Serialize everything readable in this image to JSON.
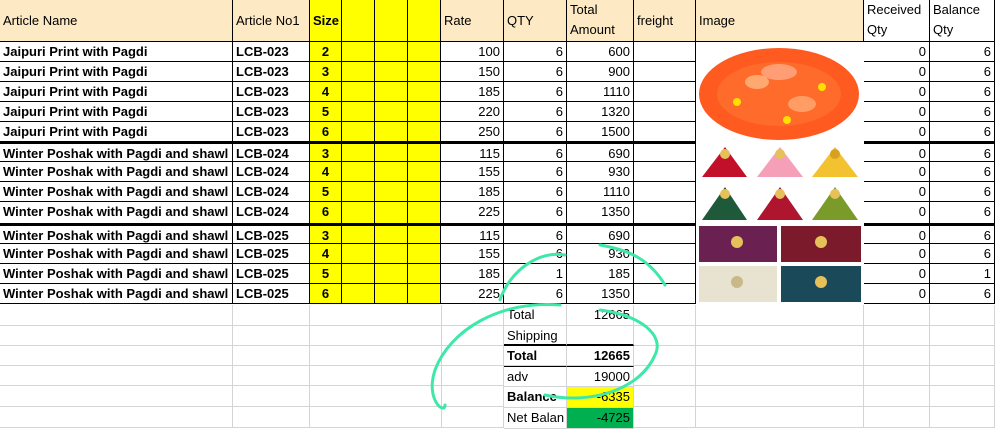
{
  "headers": {
    "article_name": "Article Name",
    "article_no": "Article No1",
    "size": "Size",
    "rate": "Rate",
    "qty": "QTY",
    "total_amount_1": "Total",
    "total_amount_2": "Amount",
    "freight": "freight",
    "image": "Image",
    "received_1": "Received",
    "received_2": "Qty",
    "balance_1": "Balance",
    "balance_2": "Qty"
  },
  "rows": [
    {
      "name": "Jaipuri Print with Pagdi",
      "no": "LCB-023",
      "size": "2",
      "rate": "100",
      "qty": "6",
      "amount": "600",
      "received": "0",
      "balance": "6"
    },
    {
      "name": "Jaipuri Print with Pagdi",
      "no": "LCB-023",
      "size": "3",
      "rate": "150",
      "qty": "6",
      "amount": "900",
      "received": "0",
      "balance": "6"
    },
    {
      "name": "Jaipuri Print with Pagdi",
      "no": "LCB-023",
      "size": "4",
      "rate": "185",
      "qty": "6",
      "amount": "1110",
      "received": "0",
      "balance": "6"
    },
    {
      "name": "Jaipuri Print with Pagdi",
      "no": "LCB-023",
      "size": "5",
      "rate": "220",
      "qty": "6",
      "amount": "1320",
      "received": "0",
      "balance": "6"
    },
    {
      "name": "Jaipuri Print with Pagdi",
      "no": "LCB-023",
      "size": "6",
      "rate": "250",
      "qty": "6",
      "amount": "1500",
      "received": "0",
      "balance": "6"
    },
    {
      "name": "Winter Poshak with Pagdi and shawl",
      "no": "LCB-024",
      "size": "3",
      "rate": "115",
      "qty": "6",
      "amount": "690",
      "received": "0",
      "balance": "6"
    },
    {
      "name": "Winter Poshak with Pagdi and shawl",
      "no": "LCB-024",
      "size": "4",
      "rate": "155",
      "qty": "6",
      "amount": "930",
      "received": "0",
      "balance": "6"
    },
    {
      "name": "Winter Poshak with Pagdi and shawl",
      "no": "LCB-024",
      "size": "5",
      "rate": "185",
      "qty": "6",
      "amount": "1110",
      "received": "0",
      "balance": "6"
    },
    {
      "name": "Winter Poshak with Pagdi and shawl",
      "no": "LCB-024",
      "size": "6",
      "rate": "225",
      "qty": "6",
      "amount": "1350",
      "received": "0",
      "balance": "6"
    },
    {
      "name": "Winter Poshak with Pagdi and shawl",
      "no": "LCB-025",
      "size": "3",
      "rate": "115",
      "qty": "6",
      "amount": "690",
      "received": "0",
      "balance": "6"
    },
    {
      "name": "Winter Poshak with Pagdi and shawl",
      "no": "LCB-025",
      "size": "4",
      "rate": "155",
      "qty": "6",
      "amount": "930",
      "received": "0",
      "balance": "6"
    },
    {
      "name": "Winter Poshak with Pagdi and shawl",
      "no": "LCB-025",
      "size": "5",
      "rate": "185",
      "qty": "1",
      "amount": "185",
      "received": "0",
      "balance": "1"
    },
    {
      "name": "Winter Poshak with Pagdi and shawl",
      "no": "LCB-025",
      "size": "6",
      "rate": "225",
      "qty": "6",
      "amount": "1350",
      "received": "0",
      "balance": "6"
    }
  ],
  "summary": {
    "total_label": "Total",
    "total_value": "12665",
    "shipping_label": "Shipping",
    "shipping_value": "",
    "grand_total_label": "Total",
    "grand_total_value": "12665",
    "adv_label": "adv",
    "adv_value": "19000",
    "balance_label": "Balance",
    "balance_value": "-6335",
    "net_balance_label": "Net Balan",
    "net_balance_value": "-4725"
  },
  "colors": {
    "header_fill": "#fde9c4",
    "size_fill": "#ffff00",
    "balance_fill": "#ffff00",
    "net_balance_fill": "#00b050",
    "annotation_stroke": "#3de8a8"
  },
  "images": {
    "lcb023": "orange-poshak-photo",
    "lcb024": "winter-poshak-photo-grid",
    "lcb025": "winter-poshak-photo-grid"
  }
}
